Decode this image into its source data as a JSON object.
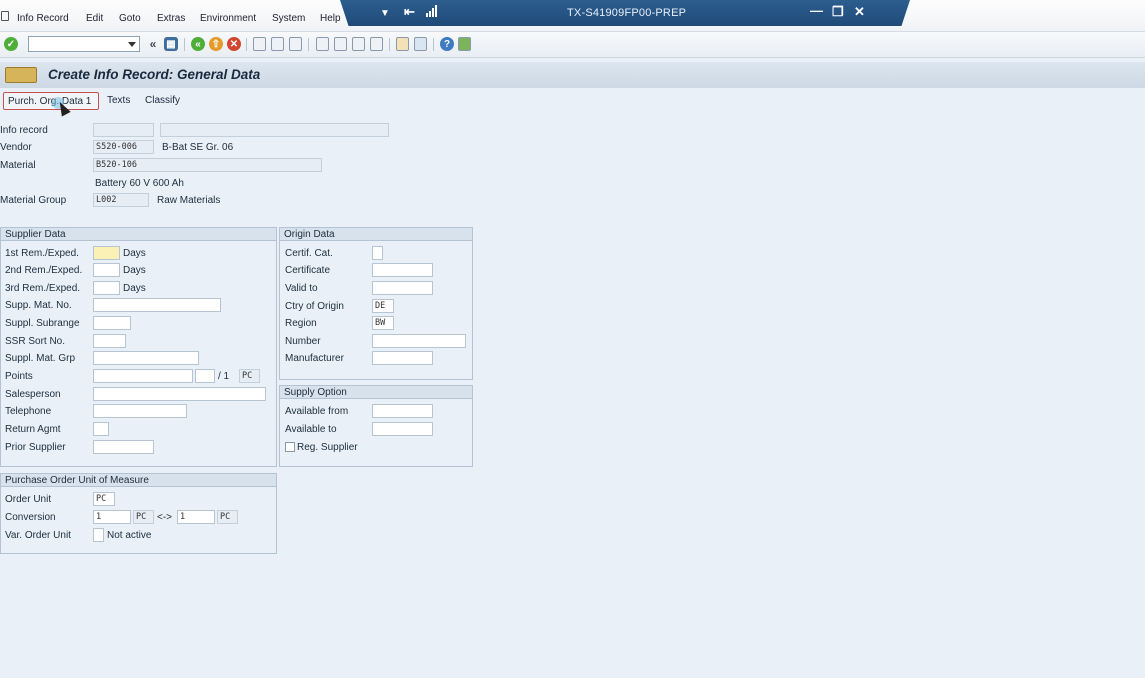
{
  "menu": {
    "items": [
      "Info Record",
      "Edit",
      "Goto",
      "Extras",
      "Environment",
      "System",
      "Help"
    ]
  },
  "window": {
    "system_title": "TX-S41909FP00-PREP"
  },
  "page": {
    "title": "Create Info Record: General Data"
  },
  "app_toolbar": {
    "tabs": [
      "Purch. Org. Data 1",
      "Texts",
      "Classify"
    ]
  },
  "header": {
    "info_record_label": "Info record",
    "vendor_label": "Vendor",
    "vendor_value": "S520-006",
    "vendor_name": "B-Bat SE Gr. 06",
    "material_label": "Material",
    "material_value": "B520-106",
    "material_desc": "Battery 60 V 600 Ah",
    "material_group_label": "Material Group",
    "material_group_value": "L002",
    "material_group_desc": "Raw Materials"
  },
  "supplier_data": {
    "title": "Supplier Data",
    "rem1_label": "1st Rem./Exped.",
    "rem2_label": "2nd Rem./Exped.",
    "rem3_label": "3rd Rem./Exped.",
    "days_unit": "Days",
    "supp_mat_no_label": "Supp. Mat. No.",
    "suppl_subrange_label": "Suppl. Subrange",
    "ssr_sort_no_label": "SSR Sort No.",
    "suppl_mat_grp_label": "Suppl. Mat. Grp",
    "points_label": "Points",
    "points_separator": "/ 1",
    "points_unit": "PC",
    "salesperson_label": "Salesperson",
    "telephone_label": "Telephone",
    "return_agmt_label": "Return Agmt",
    "prior_supplier_label": "Prior Supplier"
  },
  "origin_data": {
    "title": "Origin Data",
    "certif_cat_label": "Certif. Cat.",
    "certificate_label": "Certificate",
    "valid_to_label": "Valid to",
    "ctry_of_origin_label": "Ctry of Origin",
    "ctry_of_origin_value": "DE",
    "region_label": "Region",
    "region_value": "BW",
    "number_label": "Number",
    "manufacturer_label": "Manufacturer"
  },
  "supply_option": {
    "title": "Supply Option",
    "available_from_label": "Available from",
    "available_to_label": "Available to",
    "reg_supplier_label": "Reg. Supplier"
  },
  "po_unit": {
    "title": "Purchase Order Unit of Measure",
    "order_unit_label": "Order Unit",
    "order_unit_value": "PC",
    "conversion_label": "Conversion",
    "conv_left_value": "1",
    "conv_left_unit": "PC",
    "conv_arrow": "<->",
    "conv_right_value": "1",
    "conv_right_unit": "PC",
    "var_order_unit_label": "Var. Order Unit",
    "var_order_unit_status": "Not active"
  }
}
